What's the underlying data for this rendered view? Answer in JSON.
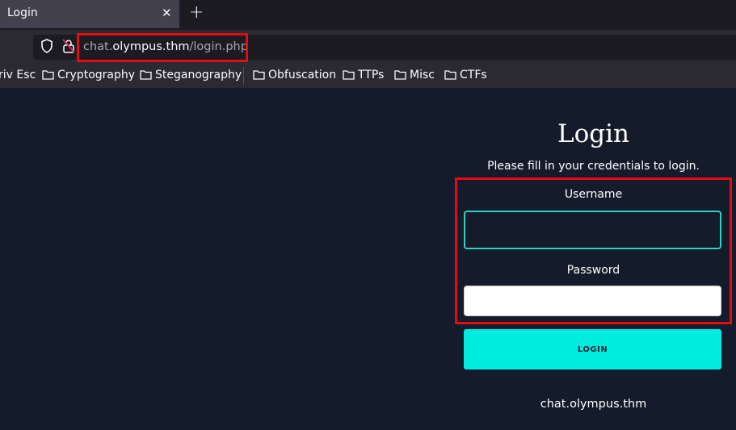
{
  "tab": {
    "title": "Login",
    "close_label": "✕",
    "new_tab_label": "+"
  },
  "urlbar": {
    "url_prefix": "chat.",
    "url_host": "olympus.thm",
    "url_path": "/login.php"
  },
  "bookmarks": [
    {
      "label": "riv Esc",
      "folder": false
    },
    {
      "label": "Cryptography",
      "folder": true
    },
    {
      "label": "Steganography",
      "folder": true
    },
    {
      "label": "Obfuscation",
      "folder": true
    },
    {
      "label": "TTPs",
      "folder": true
    },
    {
      "label": "Misc",
      "folder": true
    },
    {
      "label": "CTFs",
      "folder": true
    }
  ],
  "page": {
    "title": "Login",
    "subtitle": "Please fill in your credentials to login.",
    "username_label": "Username",
    "username_value": "",
    "password_label": "Password",
    "password_value": "",
    "login_button": "LOGIN",
    "footer": "chat.olympus.thm"
  },
  "colors": {
    "accent": "#00ece0",
    "highlight": "#e40c12",
    "background": "#141b2b"
  }
}
